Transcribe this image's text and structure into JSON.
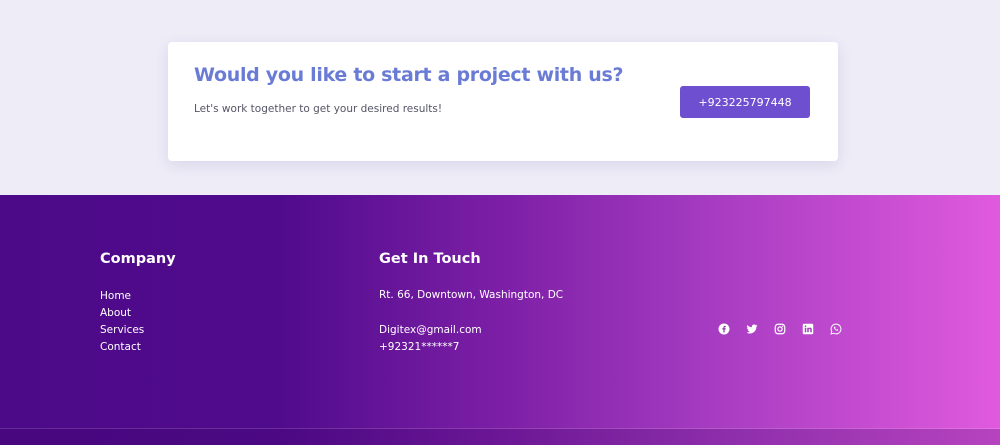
{
  "cta": {
    "title": "Would you like to start a project with us?",
    "subtitle": "Let's work together to get your desired results!",
    "button_label": "+923225797448"
  },
  "footer": {
    "company": {
      "title": "Company",
      "links": [
        "Home",
        "About",
        "Services",
        "Contact"
      ]
    },
    "contact": {
      "title": "Get In Touch",
      "address": "Rt. 66, Downtown, Washington, DC",
      "email": "Digitex@gmail.com",
      "phone": "+92321******7"
    },
    "socials": [
      "facebook-icon",
      "twitter-icon",
      "instagram-icon",
      "linkedin-icon",
      "whatsapp-icon"
    ]
  },
  "colors": {
    "accent": "#6e4fd0",
    "title": "#6a7bd6",
    "footer_start": "#4c0a88",
    "footer_end": "#e05ade"
  }
}
